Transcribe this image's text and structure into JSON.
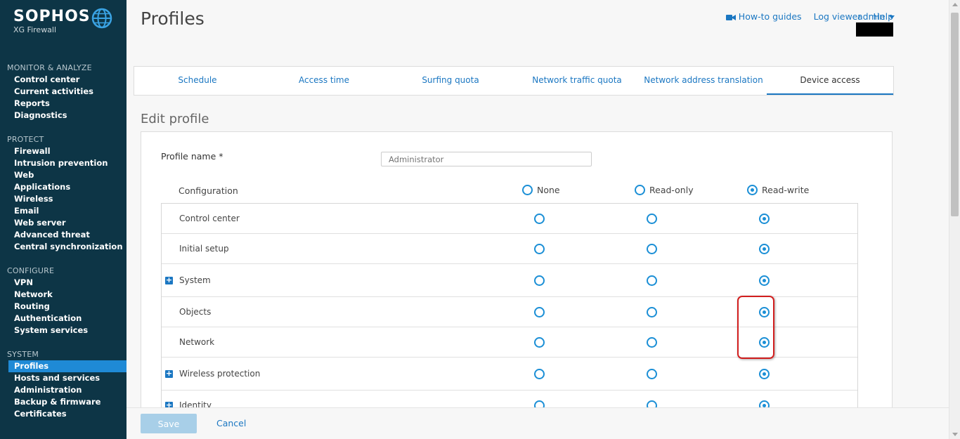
{
  "brand": {
    "name": "SOPHOS",
    "product": "XG Firewall"
  },
  "sidebar": {
    "sections": [
      {
        "title": "MONITOR & ANALYZE",
        "items": [
          "Control center",
          "Current activities",
          "Reports",
          "Diagnostics"
        ]
      },
      {
        "title": "PROTECT",
        "items": [
          "Firewall",
          "Intrusion prevention",
          "Web",
          "Applications",
          "Wireless",
          "Email",
          "Web server",
          "Advanced threat",
          "Central synchronization"
        ]
      },
      {
        "title": "CONFIGURE",
        "items": [
          "VPN",
          "Network",
          "Routing",
          "Authentication",
          "System services"
        ]
      },
      {
        "title": "SYSTEM",
        "items": [
          "Profiles",
          "Hosts and services",
          "Administration",
          "Backup & firmware",
          "Certificates"
        ]
      }
    ],
    "active_item": "Profiles"
  },
  "header": {
    "title": "Profiles",
    "links": {
      "howto": "How-to guides",
      "log": "Log viewer",
      "help": "Help"
    },
    "user": "admin"
  },
  "tabs": [
    "Schedule",
    "Access time",
    "Surfing quota",
    "Network traffic quota",
    "Network address translation",
    "Device access"
  ],
  "active_tab": "Device access",
  "form": {
    "heading": "Edit profile",
    "profile_label": "Profile name *",
    "profile_placeholder": "Administrator",
    "config_header": "Configuration",
    "columns": [
      "None",
      "Read-only",
      "Read-write"
    ],
    "header_selected": "Read-write",
    "rows": [
      {
        "label": "Control center",
        "expandable": false,
        "selected": "Read-write"
      },
      {
        "label": "Initial setup",
        "expandable": false,
        "selected": "Read-write"
      },
      {
        "label": "System",
        "expandable": true,
        "selected": "Read-write"
      },
      {
        "label": "Objects",
        "expandable": false,
        "selected": "Read-write"
      },
      {
        "label": "Network",
        "expandable": false,
        "selected": "Read-write"
      },
      {
        "label": "Wireless protection",
        "expandable": true,
        "selected": "Read-write"
      },
      {
        "label": "Identity",
        "expandable": true,
        "selected": "Read-write"
      }
    ]
  },
  "footer": {
    "save": "Save",
    "cancel": "Cancel"
  },
  "colors": {
    "sidebar_bg": "#0d3546",
    "accent": "#1b77c2",
    "highlight": "#d21f1f"
  }
}
